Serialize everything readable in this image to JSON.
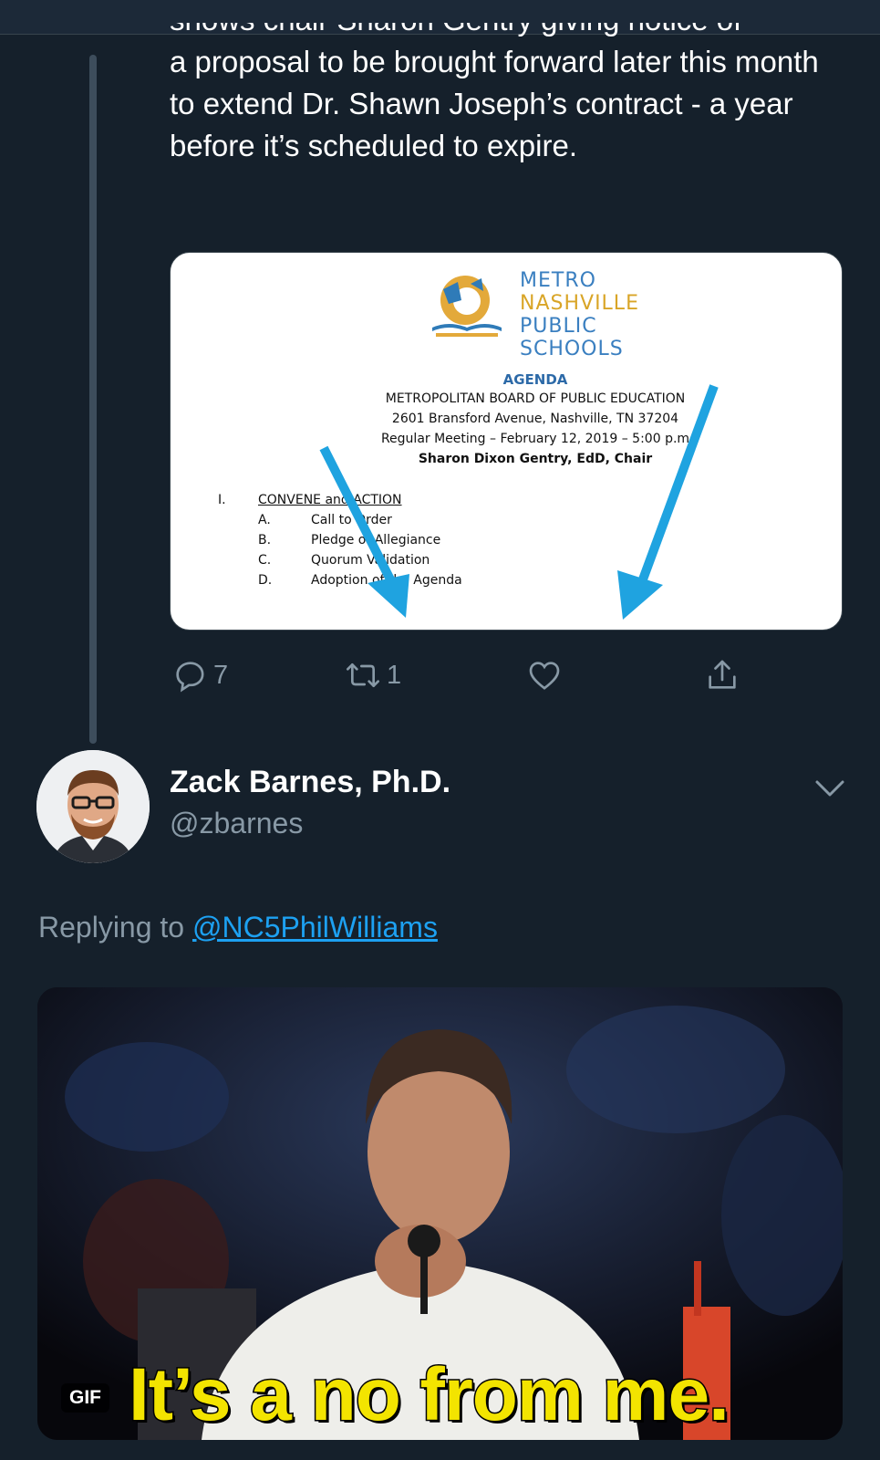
{
  "tweet": {
    "text_cut": "shows chair Sharon Gentry giving notice of",
    "text": "a proposal to be brought forward later this month to extend Dr. Shawn Joseph’s contract - a year before it’s scheduled to expire.",
    "actions": {
      "reply_count": "7",
      "retweet_count": "1",
      "like_count": "",
      "share_count": ""
    }
  },
  "document": {
    "logo_lines": [
      "METRO",
      "NASHVILLE",
      "PUBLIC",
      "SCHOOLS"
    ],
    "agenda_title": "AGENDA",
    "board": "METROPOLITAN BOARD OF PUBLIC EDUCATION",
    "address": "2601 Bransford Avenue, Nashville, TN 37204",
    "meeting": "Regular Meeting – February 12, 2019 – 5:00 p.m",
    "chair": "Sharon Dixon Gentry, EdD, Chair",
    "section_num": "I.",
    "section_title": "CONVENE and ACTION",
    "items": [
      {
        "letter": "A.",
        "text": "Call to Order"
      },
      {
        "letter": "B.",
        "text": "Pledge of Allegiance"
      },
      {
        "letter": "C.",
        "text": "Quorum Validation"
      },
      {
        "letter": "D.",
        "text": "Adoption of the Agenda"
      }
    ],
    "arrow_color": "#1fa3e0"
  },
  "reply": {
    "name": "Zack Barnes, Ph.D.",
    "handle": "@zbarnes",
    "replying_prefix": "Replying to",
    "replying_to": "@NC5PhilWilliams",
    "gif_badge": "GIF",
    "gif_caption": "It’s a no from me."
  },
  "colors": {
    "background": "#15202b",
    "muted": "#8899a6",
    "link": "#1da1f2",
    "caption": "#f3e400"
  }
}
